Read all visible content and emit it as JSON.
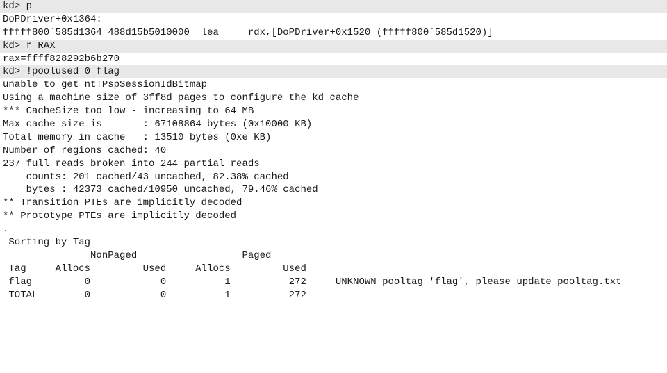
{
  "line1": "kd> p",
  "line2": "DoPDriver+0x1364:",
  "line3": "fffff800`585d1364 488d15b5010000  lea     rdx,[DoPDriver+0x1520 (fffff800`585d1520)]",
  "line4": "kd> r RAX",
  "line5": "rax=ffff828292b6b270",
  "line6": "kd> !poolused 0 flag",
  "line7": "unable to get nt!PspSessionIdBitmap",
  "line8": "Using a machine size of 3ff8d pages to configure the kd cache",
  "line9": "",
  "line10": "*** CacheSize too low - increasing to 64 MB",
  "line11": "",
  "line12": "Max cache size is       : 67108864 bytes (0x10000 KB)",
  "line13": "Total memory in cache   : 13510 bytes (0xe KB)",
  "line14": "Number of regions cached: 40",
  "line15": "237 full reads broken into 244 partial reads",
  "line16": "    counts: 201 cached/43 uncached, 82.38% cached",
  "line17": "    bytes : 42373 cached/10950 uncached, 79.46% cached",
  "line18": "** Transition PTEs are implicitly decoded",
  "line19": "** Prototype PTEs are implicitly decoded",
  "line20": ".",
  "line21": " Sorting by Tag",
  "line22": "",
  "line23": "               NonPaged                  Paged",
  "line24": " Tag     Allocs         Used     Allocs         Used",
  "line25": "",
  "line26": " flag         0            0          1          272     UNKNOWN pooltag 'flag', please update pooltag.txt",
  "line27": "",
  "line28": " TOTAL        0            0          1          272"
}
